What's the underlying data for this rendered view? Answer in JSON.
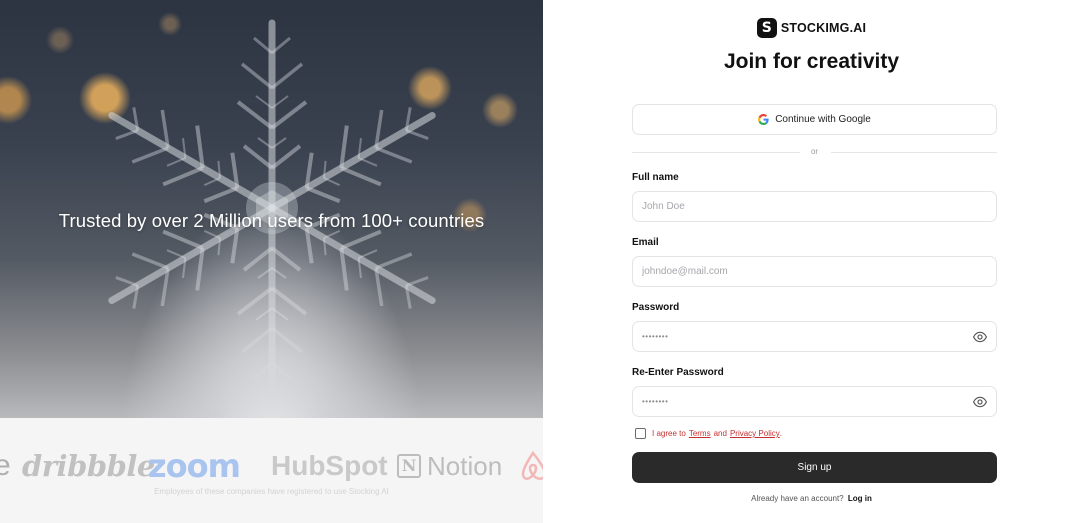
{
  "hero": {
    "tagline": "Trusted by over 2 Million users from 100+ countries"
  },
  "logos": {
    "items": [
      "dribbble",
      "zoom",
      "HubSpot",
      "Notion"
    ],
    "caption": "Employees of these companies have registered to use Stocking AI"
  },
  "brand": {
    "name": "STOCKIMG.AI",
    "icon_letter": "S"
  },
  "form": {
    "title": "Join for creativity",
    "google_label": "Continue with Google",
    "divider_text": "or",
    "full_name": {
      "label": "Full name",
      "placeholder": "John Doe"
    },
    "email": {
      "label": "Email",
      "placeholder": "johndoe@mail.com"
    },
    "password": {
      "label": "Password",
      "masked_value": "••••••••"
    },
    "reenter_password": {
      "label": "Re-Enter Password",
      "masked_value": "••••••••"
    },
    "agree": {
      "prefix": "I agree to",
      "terms": "Terms",
      "and": "and",
      "privacy": "Privacy Policy",
      "suffix": "."
    },
    "signup_label": "Sign up",
    "login_prompt": "Already have an account?",
    "login_link": "Log in"
  },
  "colors": {
    "accent": "#2a2a2a",
    "link_red": "#c53030",
    "border": "#e4e4e7"
  }
}
